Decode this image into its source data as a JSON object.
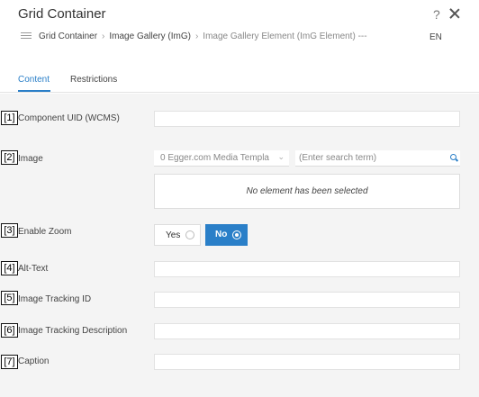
{
  "dialog": {
    "title": "Grid Container",
    "help_label": "?",
    "language": "EN"
  },
  "breadcrumb": [
    "Grid Container",
    "Image Gallery (ImG)",
    "Image Gallery Element (ImG Element) ---"
  ],
  "breadcrumb_separator": "›",
  "tabs": [
    {
      "label": "Content",
      "active": true
    },
    {
      "label": "Restrictions",
      "active": false
    }
  ],
  "fields": [
    {
      "number": "[1]",
      "label": "Component UID (WCMS)",
      "value": ""
    },
    {
      "number": "[2]",
      "label": "Image"
    },
    {
      "number": "[3]",
      "label": "Enable Zoom"
    },
    {
      "number": "[4]",
      "label": "Alt-Text",
      "value": ""
    },
    {
      "number": "[5]",
      "label": "Image Tracking ID",
      "value": ""
    },
    {
      "number": "[6]",
      "label": "Image Tracking Description",
      "value": ""
    },
    {
      "number": "[7]",
      "label": "Caption",
      "value": ""
    }
  ],
  "image": {
    "source_selected": "0 Egger.com Media Templa",
    "search_placeholder": "(Enter search term)",
    "empty_message": "No element has been selected"
  },
  "zoom": {
    "yes_label": "Yes",
    "no_label": "No",
    "selected": "No"
  },
  "colors": {
    "accent": "#2a7fc8",
    "background": "#f4f4f4",
    "header_bg": "#ffffff"
  }
}
